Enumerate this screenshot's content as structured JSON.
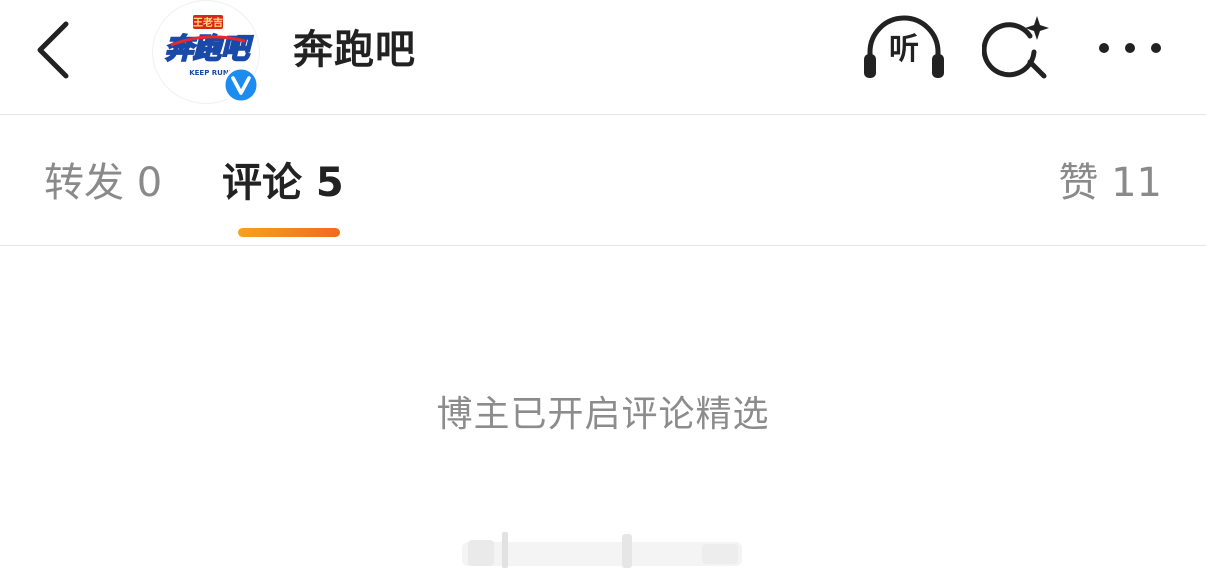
{
  "header": {
    "back_icon": "chevron-left-icon",
    "title": "奔跑吧",
    "avatar": {
      "logo_text_top": "王老吉",
      "logo_text_main": "奔跑吧",
      "logo_text_sub": "KEEP RUNNING",
      "verified_icon": "verified-v-icon"
    },
    "listen_label": "听",
    "search_icon": "search-sparkle-icon",
    "more_icon": "more-dots-icon"
  },
  "tabs": {
    "repost": "转发 0",
    "comment": "评论 5",
    "like": "赞 11"
  },
  "content": {
    "notice": "博主已开启评论精选"
  },
  "colors": {
    "accent_start": "#f7a21b",
    "accent_end": "#f26b1d",
    "verified_blue": "#1d8cf0",
    "text_primary": "#222222",
    "text_secondary": "#8a8a8a"
  }
}
